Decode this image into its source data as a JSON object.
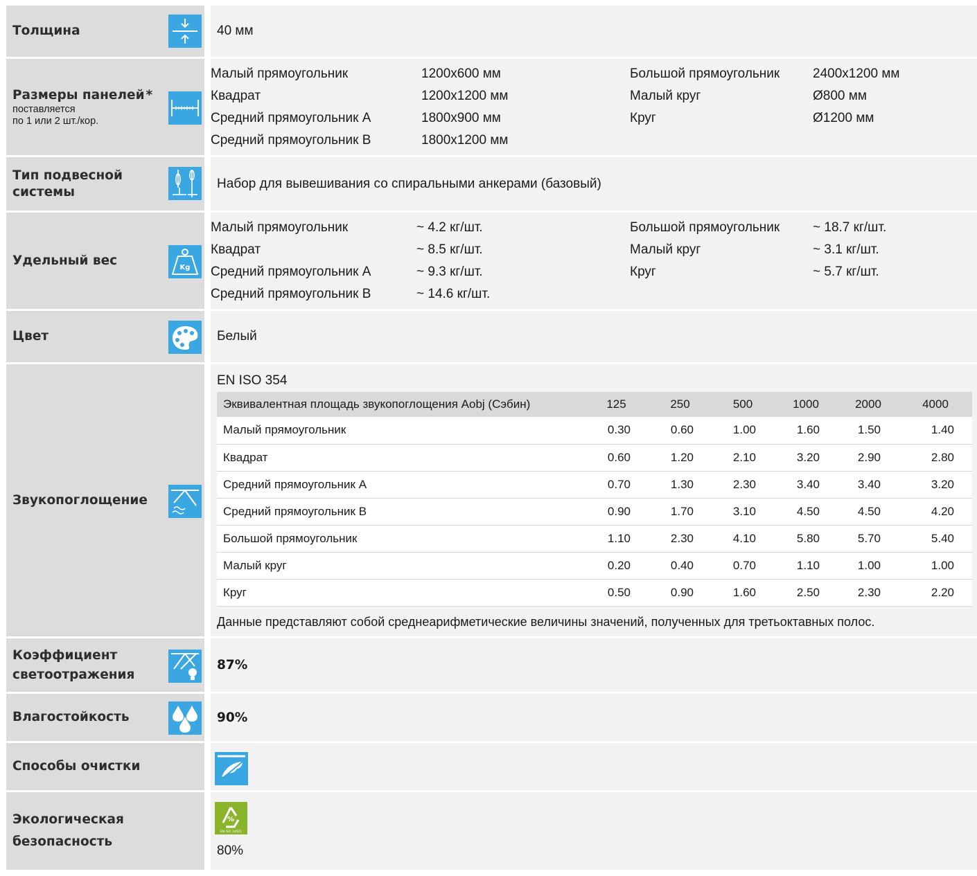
{
  "thickness": {
    "label": "Толщина",
    "value": "40 мм",
    "icon": "thickness-arrows-icon"
  },
  "sizes": {
    "label": "Размеры панелей",
    "asterisk": "*",
    "note_line1": "поставляется",
    "note_line2": "по 1 или 2 шт./кор.",
    "icon": "width-dimension-icon",
    "left": [
      {
        "name": "Малый прямоугольник",
        "value": "1200x600 мм"
      },
      {
        "name": "Квадрат",
        "value": "1200x1200 мм"
      },
      {
        "name": "Средний прямоугольник A",
        "value": "1800x900 мм"
      },
      {
        "name": "Средний прямоугольник B",
        "value": "1800x1200 мм"
      }
    ],
    "right": [
      {
        "name": "Большой прямоугольник",
        "value": "2400x1200 мм"
      },
      {
        "name": "Малый круг",
        "value": "Ø800 мм"
      },
      {
        "name": "Круг",
        "value": "Ø1200 мм"
      }
    ]
  },
  "suspension": {
    "label_line1": "Тип подвесной",
    "label_line2": "системы",
    "value": "Набор для вывешивания со спиральными анкерами (базовый)",
    "icon": "suspension-anchor-icon"
  },
  "weight": {
    "label": "Удельный вес",
    "icon": "weight-kg-icon",
    "left": [
      {
        "name": "Малый прямоугольник",
        "value": "~ 4.2 кг/шт."
      },
      {
        "name": "Квадрат",
        "value": "~ 8.5 кг/шт."
      },
      {
        "name": "Средний прямоугольник A",
        "value": "~ 9.3 кг/шт."
      },
      {
        "name": "Средний прямоугольник B",
        "value": "~ 14.6 кг/шт."
      }
    ],
    "right": [
      {
        "name": "Большой прямоугольник",
        "value": "~ 18.7 кг/шт."
      },
      {
        "name": "Малый круг",
        "value": "~ 3.1 кг/шт."
      },
      {
        "name": "Круг",
        "value": "~ 5.7 кг/шт."
      }
    ]
  },
  "color": {
    "label": "Цвет",
    "value": "Белый",
    "icon": "palette-icon"
  },
  "absorption": {
    "label": "Звукопоглощение",
    "icon": "sound-absorption-icon",
    "standard": "EN ISO 354",
    "header": [
      "Эквивалентная площадь звукопоглощения Aobj (Сэбин)",
      "125",
      "250",
      "500",
      "1000",
      "2000",
      "4000"
    ],
    "rows": [
      [
        "Малый прямоугольник",
        "0.30",
        "0.60",
        "1.00",
        "1.60",
        "1.50",
        "1.40"
      ],
      [
        "Квадрат",
        "0.60",
        "1.20",
        "2.10",
        "3.20",
        "2.90",
        "2.80"
      ],
      [
        "Средний прямоугольник A",
        "0.70",
        "1.30",
        "2.30",
        "3.40",
        "3.40",
        "3.20"
      ],
      [
        "Средний прямоугольник B",
        "0.90",
        "1.70",
        "3.10",
        "4.50",
        "4.50",
        "4.20"
      ],
      [
        "Большой прямоугольник",
        "1.10",
        "2.30",
        "4.10",
        "5.80",
        "5.70",
        "5.40"
      ],
      [
        "Малый круг",
        "0.20",
        "0.40",
        "0.70",
        "1.10",
        "1.00",
        "1.00"
      ],
      [
        "Круг",
        "0.50",
        "0.90",
        "1.60",
        "2.50",
        "2.30",
        "2.20"
      ]
    ],
    "footnote": "Данные представляют собой среднеарифметические величины значений, полученных для третьоктавных полос."
  },
  "reflectance": {
    "label_line1": "Коэффициент",
    "label_line2": "светоотражения",
    "value": "87%",
    "icon": "light-reflection-icon"
  },
  "humidity": {
    "label": "Влагостойкость",
    "value": "90%",
    "icon": "water-drops-icon"
  },
  "cleaning": {
    "label": "Способы очистки",
    "icon": "feather-duster-icon"
  },
  "eco": {
    "label_line1": "Экологическая",
    "label_line2": "безопасность",
    "value": "80%",
    "icon": "recycle-iso-icon",
    "icon_percent": "%",
    "icon_caption": "EN ISO 14021"
  },
  "colors": {
    "label_bg": "#dcdcdc",
    "value_bg": "#f2f2f2",
    "icon_blue": "#3aa6e2",
    "icon_green": "#8ab42c"
  }
}
